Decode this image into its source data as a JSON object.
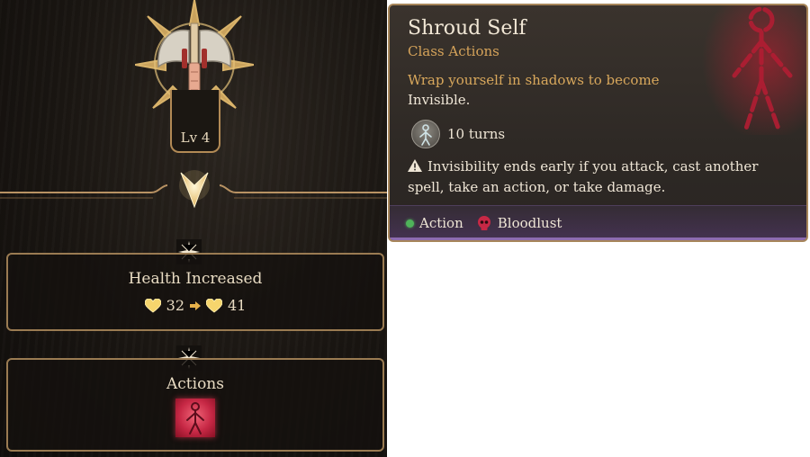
{
  "level_panel": {
    "level_label": "Lv 4",
    "health": {
      "title": "Health Increased",
      "from": "32",
      "to": "41"
    },
    "actions": {
      "title": "Actions",
      "tile_icon": "shadow-figure-icon"
    }
  },
  "tooltip": {
    "title": "Shroud Self",
    "subtitle": "Class Actions",
    "description_highlight": "Wrap yourself in shadows to become",
    "description_plain": "Invisible.",
    "duration": "10 turns",
    "warning": "Invisibility ends early if you attack, cast another spell, take an action, or take damage.",
    "footer": {
      "cost_label": "Action",
      "resource_label": "Bloodlust"
    }
  },
  "colors": {
    "gold": "#d6a35a",
    "text": "#efe6d6",
    "frame": "#a7865a",
    "action_green": "#4fb35a",
    "blood_red": "#c72845"
  }
}
